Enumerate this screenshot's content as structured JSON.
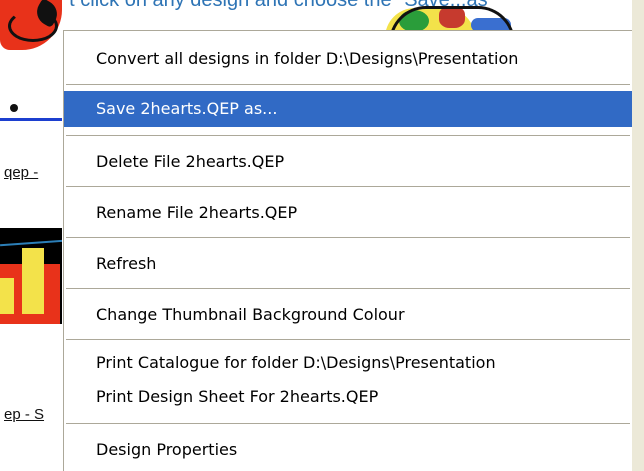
{
  "background": {
    "caption": "Right click on any design and choose the \"Save...as\"",
    "thumb_label_1": "qep -",
    "thumb_label_2": "ep - S"
  },
  "context_menu": {
    "items": [
      {
        "label": "Convert all designs in folder D:\\Designs\\Presentation",
        "highlighted": false
      },
      {
        "label": "Save 2hearts.QEP as...",
        "highlighted": true
      },
      {
        "label": "Delete File 2hearts.QEP",
        "highlighted": false
      },
      {
        "label": "Rename File 2hearts.QEP",
        "highlighted": false
      },
      {
        "label": "Refresh",
        "highlighted": false
      },
      {
        "label": "Change Thumbnail Background Colour",
        "highlighted": false
      },
      {
        "label": "Print Catalogue for folder D:\\Designs\\Presentation",
        "highlighted": false
      },
      {
        "label": "Print Design Sheet For 2hearts.QEP",
        "highlighted": false
      },
      {
        "label": "Design Properties",
        "highlighted": false
      }
    ]
  },
  "colors": {
    "highlight": "#316ac5",
    "caption_text": "#2e74b5",
    "menu_background": "#ffffff"
  }
}
